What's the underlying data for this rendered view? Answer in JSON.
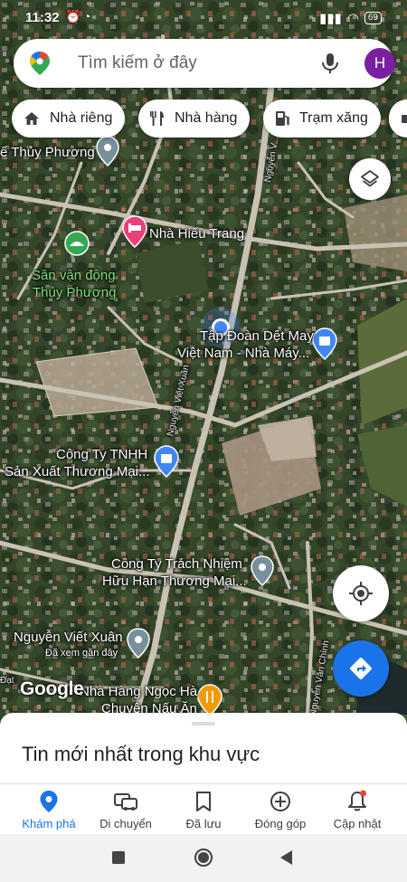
{
  "status": {
    "time": "11:32",
    "battery": "69"
  },
  "search": {
    "placeholder": "Tìm kiếm ở đây",
    "avatar_letter": "H"
  },
  "chips": [
    {
      "label": "Nhà riêng"
    },
    {
      "label": "Nhà hàng"
    },
    {
      "label": "Trạm xăng"
    }
  ],
  "map": {
    "labels": {
      "thuy_phuong": "ế Thủy Phương",
      "nha_hieu_trang": "Nhà Hiếu Trang",
      "san_van_dong_1": "Sân vận động",
      "san_van_dong_2": "Thủy Phương",
      "tap_doan_1": "Tập Đoàn Dệt May",
      "tap_doan_2": "Việt Nam - Nhà Máy...",
      "cong_ty_tnhh_1": "Công Ty TNHH",
      "cong_ty_tnhh_2": "Sản Xuất Thương Mại...",
      "cong_ty_tn_1": "Công Ty Trách Nhiệm",
      "cong_ty_tn_2": "Hữu Hạn Thương Mại...",
      "nguyen_viet_xuan": "Nguyễn Viết Xuân",
      "da_xem": "Đã xem gần đây",
      "nha_hang_1": "Nhà Hàng Ngọc Hà",
      "nha_hang_2": "Chuyên Nấu Ăn",
      "road_nvx": "Nguyễn Viết Xuân",
      "road_nvx2": "Nguyễn V...",
      "road_nvc": "Nguyễn Văn Chính",
      "road_dat": "Đạt"
    },
    "watermark": "Google"
  },
  "sheet": {
    "title": "Tin mới nhất trong khu vực"
  },
  "nav": [
    {
      "label": "Khám phá",
      "icon": "place-icon",
      "active": true
    },
    {
      "label": "Di chuyển",
      "icon": "car-icon",
      "active": false
    },
    {
      "label": "Đã lưu",
      "icon": "bookmark-icon",
      "active": false
    },
    {
      "label": "Đóng góp",
      "icon": "add-circle-icon",
      "active": false
    },
    {
      "label": "Cập nhật",
      "icon": "bell-icon",
      "active": false
    }
  ],
  "colors": {
    "accent": "#1a73e8",
    "restaurant_pin": "#f29900",
    "hotel_pin": "#ec407a",
    "park_pin": "#34a853",
    "avatar": "#7b1fa2"
  }
}
